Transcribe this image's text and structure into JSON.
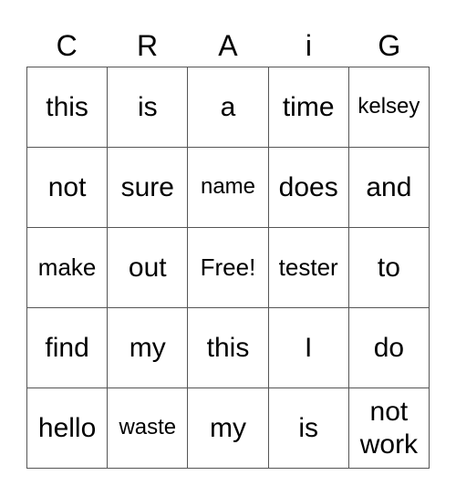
{
  "header": [
    "C",
    "R",
    "A",
    "i",
    "G"
  ],
  "grid": [
    [
      "this",
      "is",
      "a",
      "time",
      "kelsey"
    ],
    [
      "not",
      "sure",
      "name",
      "does",
      "and"
    ],
    [
      "make",
      "out",
      "Free!",
      "tester",
      "to"
    ],
    [
      "find",
      "my",
      "this",
      "I",
      "do"
    ],
    [
      "hello",
      "waste",
      "my",
      "is",
      "not work"
    ]
  ]
}
